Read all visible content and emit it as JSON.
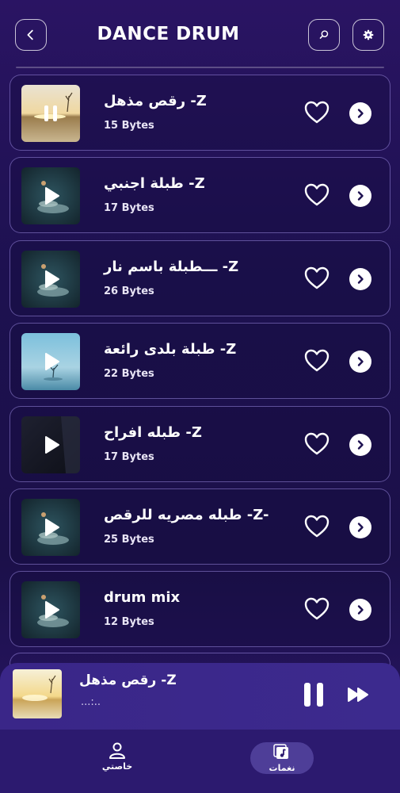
{
  "header": {
    "title": "DANCE DRUM"
  },
  "tracks": [
    {
      "name": "رقص مذهل -Z",
      "size": "15 Bytes",
      "state": "playing",
      "thumb": "sunset"
    },
    {
      "name": "طبلة اجنبي -Z",
      "size": "17 Bytes",
      "state": "paused",
      "thumb": "teal"
    },
    {
      "name": "ـــطبلة باسم نار -Z",
      "size": "26 Bytes",
      "state": "paused",
      "thumb": "teal"
    },
    {
      "name": "طبلة بلدى رائعة -Z",
      "size": "22 Bytes",
      "state": "paused",
      "thumb": "sky"
    },
    {
      "name": "طبله افراح -Z",
      "size": "17 Bytes",
      "state": "paused",
      "thumb": "dark"
    },
    {
      "name": "طبله مصريه للرقص -Z-",
      "size": "25 Bytes",
      "state": "paused",
      "thumb": "teal"
    },
    {
      "name": "drum mix",
      "size": "12 Bytes",
      "state": "paused",
      "thumb": "teal"
    }
  ],
  "player": {
    "title": "رقص مذهل -Z",
    "subtitle": "...:.."
  },
  "nav": {
    "profile_label": "خاصتي",
    "ringtones_label": "نغمات"
  },
  "colors": {
    "background": "#1d1150",
    "card_border": "#8a78d0",
    "player": "#3a2688",
    "nav": "#2c1a6f"
  },
  "icons": [
    "back-arrow-icon",
    "search-icon",
    "gear-icon",
    "play-icon",
    "pause-icon",
    "heart-icon",
    "chevron-right-icon",
    "fast-forward-icon",
    "person-icon",
    "music-note-icon"
  ]
}
